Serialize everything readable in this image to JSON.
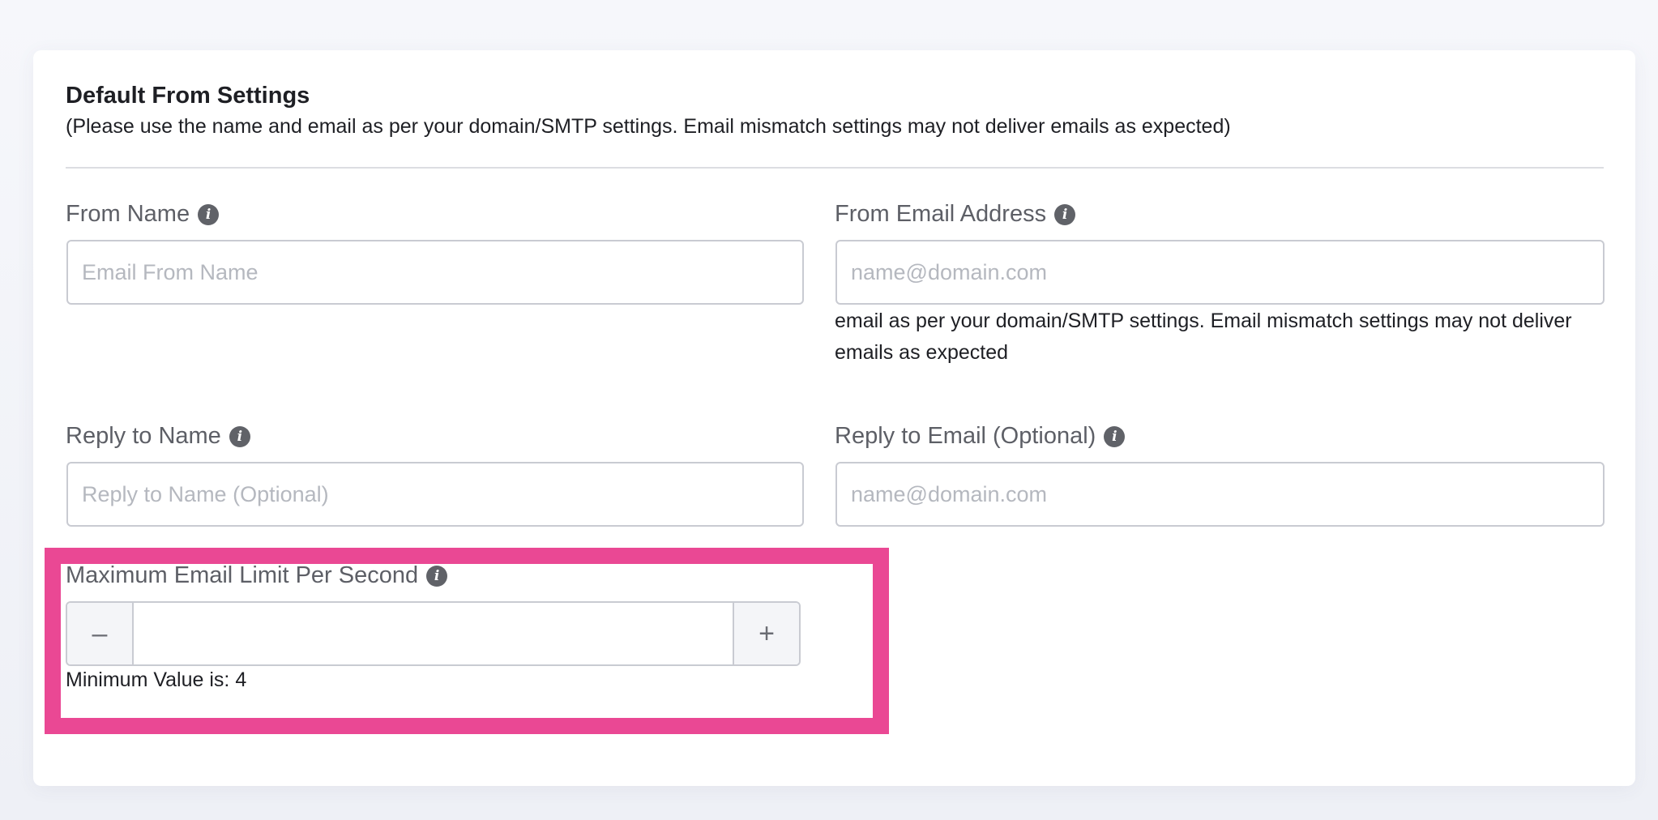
{
  "section": {
    "title": "Default From Settings",
    "subtitle": "(Please use the name and email as per your domain/SMTP settings. Email mismatch settings may not deliver emails as expected)"
  },
  "fields": {
    "from_name": {
      "label": "From Name",
      "placeholder": "Email From Name",
      "value": ""
    },
    "from_email": {
      "label": "From Email Address",
      "placeholder": "name@domain.com",
      "value": "",
      "hint": "email as per your domain/SMTP settings. Email mismatch settings may not deliver emails as expected"
    },
    "reply_name": {
      "label": "Reply to Name",
      "placeholder": "Reply to Name (Optional)",
      "value": ""
    },
    "reply_email": {
      "label": "Reply to Email (Optional)",
      "placeholder": "name@domain.com",
      "value": ""
    },
    "max_limit": {
      "label": "Maximum Email Limit Per Second",
      "value": "",
      "minus_symbol": "–",
      "plus_symbol": "+",
      "min_note": "Minimum Value is: 4"
    }
  },
  "icons": {
    "info": "info-icon",
    "info_glyph": "i"
  },
  "colors": {
    "highlight": "#ea4894",
    "label": "#5d5f66",
    "info_icon": "#606268"
  }
}
